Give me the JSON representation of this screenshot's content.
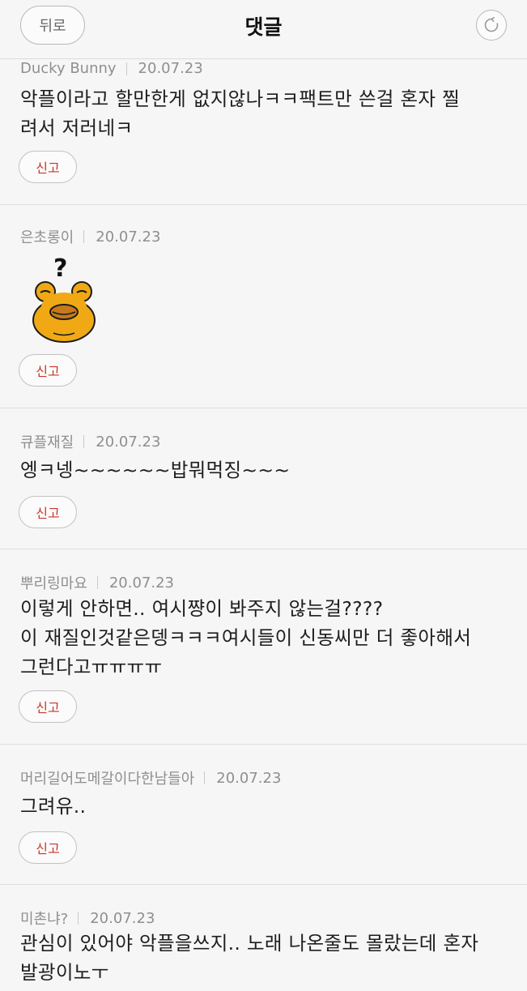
{
  "header": {
    "back_label": "뒤로",
    "title": "댓글",
    "refresh_icon": "refresh-icon"
  },
  "comments": [
    {
      "author": "Ducky Bunny",
      "date": "20.07.23",
      "lines": [
        "악플이라고 할만한게 없지않나ㅋㅋ팩트만 쓴걸 혼자 찔",
        "려서 저러네ㅋ"
      ],
      "report_label": "신고"
    },
    {
      "author": "은초롱이",
      "date": "20.07.23",
      "sticker": "question-frog-sticker",
      "report_label": "신고"
    },
    {
      "author": "큐플재질",
      "date": "20.07.23",
      "lines": [
        "엥ㅋ넹~~~~~~밥뭐먹징~~~"
      ],
      "report_label": "신고"
    },
    {
      "author": "뿌리링마요",
      "date": "20.07.23",
      "lines": [
        "이렇게 안하면.. 여시쨩이 봐주지 않는걸????",
        "이 재질인것같은뎅ㅋㅋㅋ여시들이 신동씨만 더 좋아해서",
        "그런다고ㅠㅠㅠㅠ"
      ],
      "report_label": "신고"
    },
    {
      "author": "머리길어도메갈이다한남들아",
      "date": "20.07.23",
      "lines": [
        "그려유.."
      ],
      "report_label": "신고"
    },
    {
      "author": "미촌냐?",
      "date": "20.07.23",
      "lines": [
        "관심이 있어야 악플을쓰지.. 노래 나온줄도 몰랐는데 혼자",
        "발광이노ㅜ"
      ]
    }
  ],
  "colors": {
    "report_text": "#c8362a",
    "meta_text": "#8f8f8f",
    "background": "#f7f6f6"
  }
}
